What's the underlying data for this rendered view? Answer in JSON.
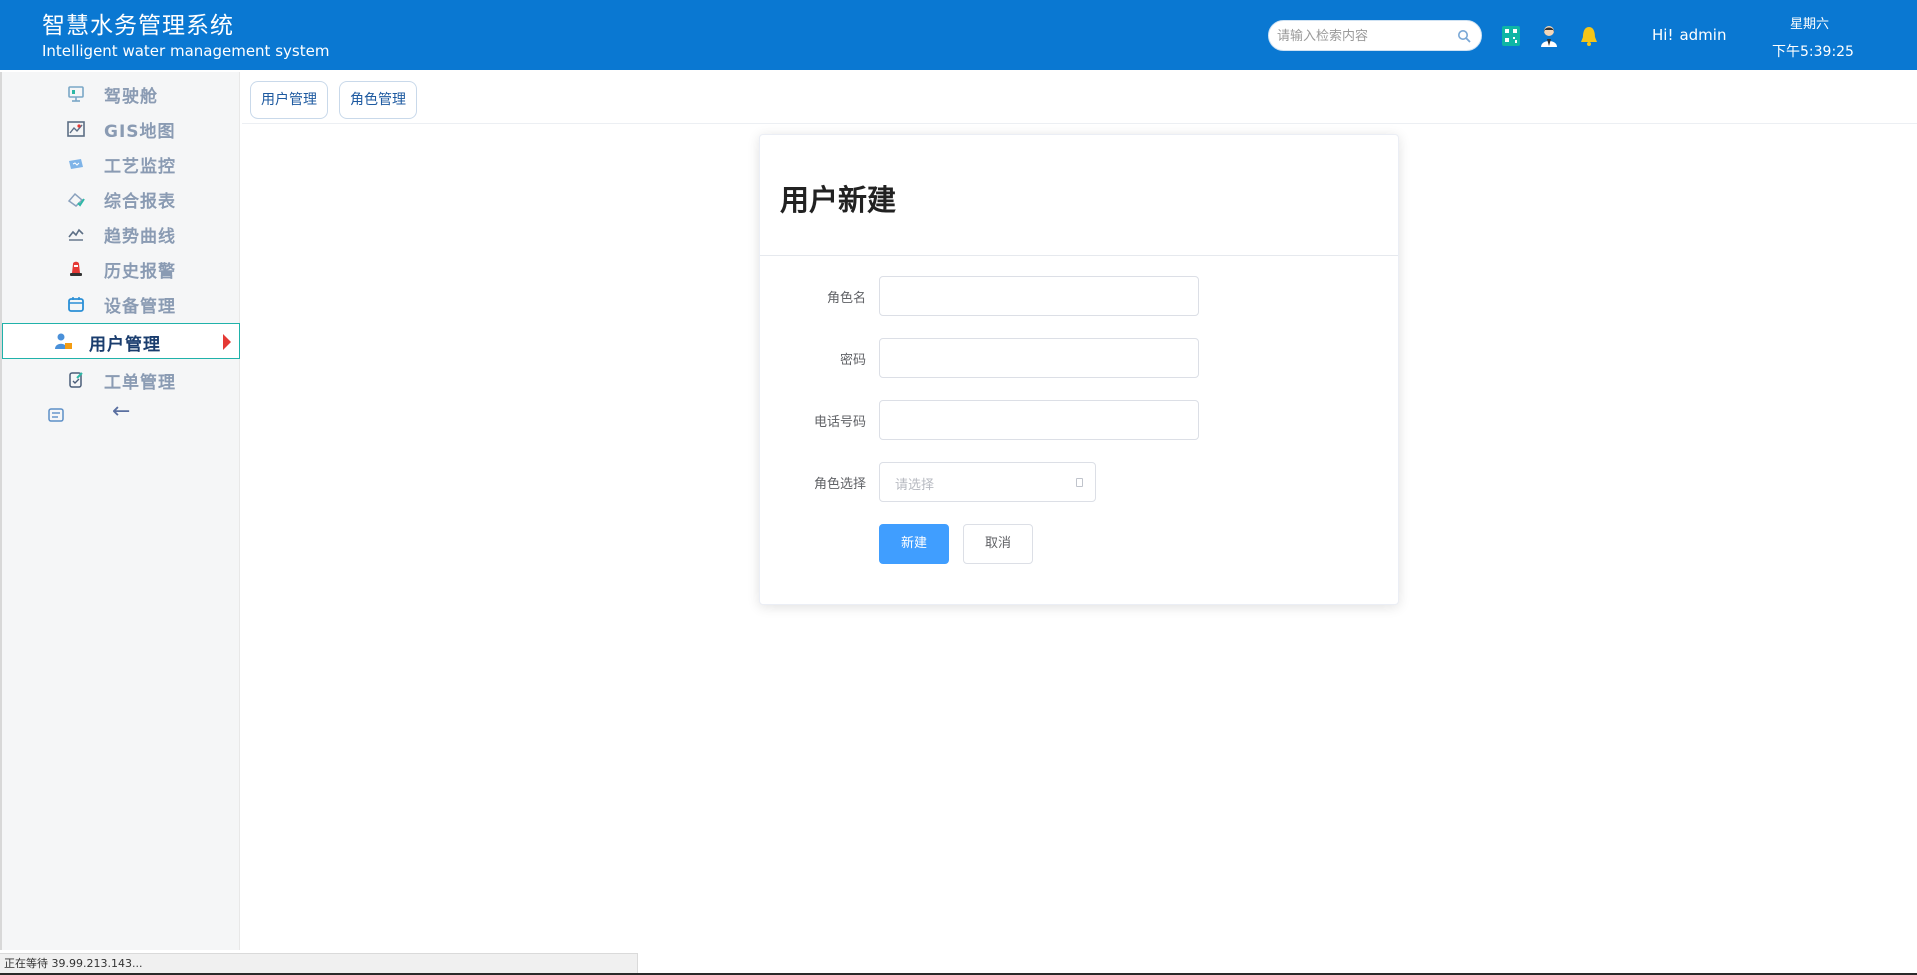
{
  "header": {
    "title": "智慧水务管理系统",
    "subtitle": "Intelligent water management system",
    "search_placeholder": "请输入检索内容",
    "greeting": "Hi!",
    "username": "admin",
    "weekday": "星期六",
    "time": "下午5:39:25",
    "icons": [
      "search-icon",
      "qrcode-icon",
      "user-profile-icon",
      "bell-icon"
    ]
  },
  "sidebar": {
    "items": [
      {
        "label": "驾驶舱",
        "icon": "cockpit-icon"
      },
      {
        "label": "GIS地图",
        "icon": "map-icon"
      },
      {
        "label": "工艺监控",
        "icon": "monitor-icon"
      },
      {
        "label": "综合报表",
        "icon": "report-icon"
      },
      {
        "label": "趋势曲线",
        "icon": "trend-icon"
      },
      {
        "label": "历史报警",
        "icon": "alarm-icon"
      },
      {
        "label": "设备管理",
        "icon": "device-icon"
      },
      {
        "label": "用户管理",
        "icon": "user-manage-icon",
        "active": true
      },
      {
        "label": "工单管理",
        "icon": "workorder-icon"
      }
    ],
    "collapse_label": "←"
  },
  "tabs": [
    {
      "label": "用户管理"
    },
    {
      "label": "角色管理"
    }
  ],
  "form": {
    "title": "用户新建",
    "fields": [
      {
        "label": "角色名",
        "value": ""
      },
      {
        "label": "密码",
        "value": ""
      },
      {
        "label": "电话号码",
        "value": ""
      }
    ],
    "select": {
      "label": "角色选择",
      "placeholder": "请选择"
    },
    "submit_label": "新建",
    "cancel_label": "取消"
  },
  "status_bar": {
    "text": "正在等待 39.99.213.143..."
  },
  "colors": {
    "header_bg": "#0a78d2",
    "primary": "#409eff",
    "active_border": "#20b2aa",
    "active_caret": "#e53935"
  }
}
